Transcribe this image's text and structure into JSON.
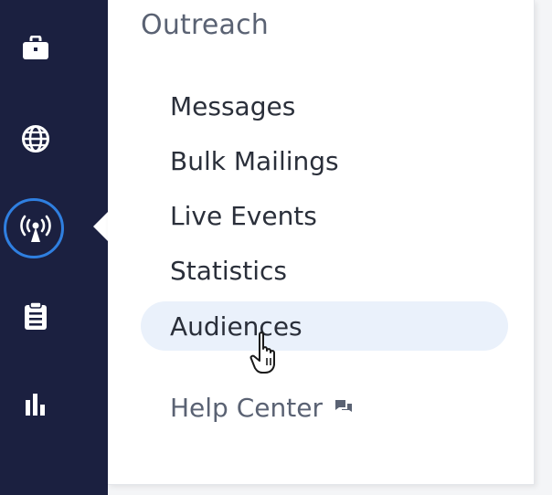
{
  "rail": {
    "items": [
      {
        "icon": "briefcase-icon",
        "active": false
      },
      {
        "icon": "globe-icon",
        "active": false
      },
      {
        "icon": "broadcast-icon",
        "active": true
      },
      {
        "icon": "clipboard-icon",
        "active": false
      },
      {
        "icon": "bar-chart-icon",
        "active": false
      }
    ],
    "background": "#1b2040",
    "active_ring_color": "#2f7fe0"
  },
  "panel": {
    "title": "Outreach",
    "items": [
      {
        "label": "Messages"
      },
      {
        "label": "Bulk Mailings"
      },
      {
        "label": "Live Events"
      },
      {
        "label": "Statistics"
      },
      {
        "label": "Audiences",
        "hovered": true
      }
    ],
    "help": {
      "label": "Help Center",
      "icon": "chat-icon"
    }
  },
  "colors": {
    "hover_bg": "#eaf1fb",
    "text": "#2a2f3a",
    "muted_text": "#5a6273"
  }
}
